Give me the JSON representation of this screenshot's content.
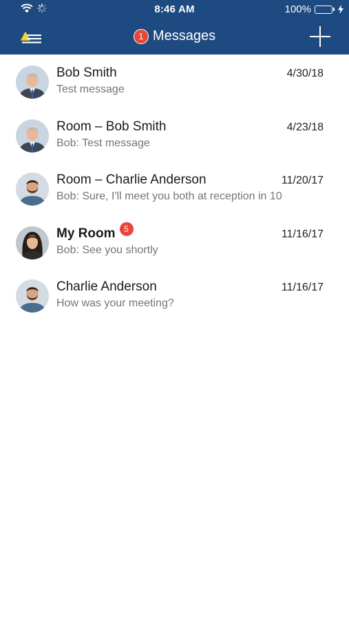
{
  "status_bar": {
    "time": "8:46 AM",
    "battery": "100%",
    "icons": [
      "wifi-icon",
      "activity-spinner-icon",
      "battery-icon",
      "charging-bolt-icon"
    ]
  },
  "nav": {
    "title": "Messages",
    "badge_count": "1",
    "left_icon": "menu-alert-icon",
    "right_icon": "plus-icon"
  },
  "colors": {
    "header_bg": "#1d4a80",
    "badge": "#e8463a",
    "battery": "#4cd964",
    "preview_text": "#757575"
  },
  "conversations": [
    {
      "name": "Bob Smith",
      "date": "4/30/18",
      "preview": "Test message",
      "avatar": "bob-smith",
      "bold": false,
      "unread": ""
    },
    {
      "name": "Room – Bob Smith",
      "date": "4/23/18",
      "preview": "Bob: Test message",
      "avatar": "bob-smith",
      "bold": false,
      "unread": ""
    },
    {
      "name": "Room – Charlie Anderson",
      "date": "11/20/17",
      "preview": "Bob: Sure, I'll meet you both at reception in 10",
      "avatar": "charlie-anderson",
      "bold": false,
      "unread": ""
    },
    {
      "name": "My Room",
      "date": "11/16/17",
      "preview": "Bob: See you shortly",
      "avatar": "woman",
      "bold": true,
      "unread": "5"
    },
    {
      "name": "Charlie Anderson",
      "date": "11/16/17",
      "preview": "How was your meeting?",
      "avatar": "charlie-anderson",
      "bold": false,
      "unread": ""
    }
  ]
}
